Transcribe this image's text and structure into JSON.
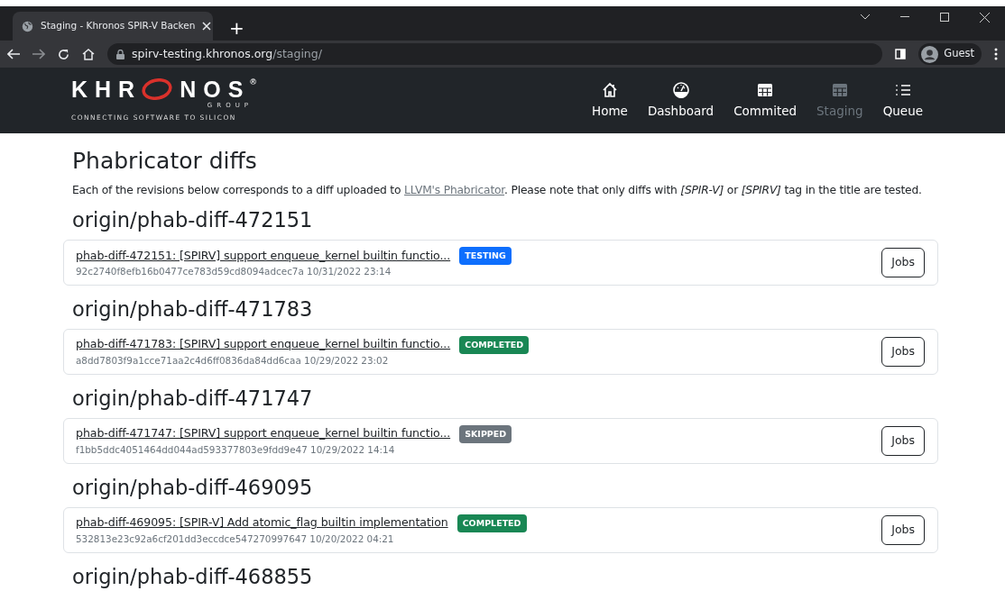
{
  "browser": {
    "tab_title": "Staging - Khronos SPIR-V Backen",
    "new_tab": "+",
    "address_host": "spirv-testing.khronos.org",
    "address_path": "/staging/",
    "profile": "Guest"
  },
  "navbar": {
    "logo": {
      "left": "KHR",
      "right": "NOS",
      "mark": "®",
      "group": "GROUP",
      "tagline": "CONNECTING SOFTWARE TO SILICON"
    },
    "items": [
      {
        "label": "Home",
        "kind": "home",
        "selected": false
      },
      {
        "label": "Dashboard",
        "kind": "gauge",
        "selected": false
      },
      {
        "label": "Commited",
        "kind": "table",
        "selected": false
      },
      {
        "label": "Staging",
        "kind": "table",
        "selected": true
      },
      {
        "label": "Queue",
        "kind": "list",
        "selected": false
      }
    ]
  },
  "page": {
    "title": "Phabricator diffs",
    "intro_before": "Each of the revisions below corresponds to a diff uploaded to ",
    "intro_link": "LLVM's Phabricator",
    "intro_after": ". Please note that only diffs with *[SPIR-V]* or *[SPIRV]* tag in the title are tested."
  },
  "diffs": [
    {
      "branch": "origin/phab-diff-472151",
      "title": "phab-diff-472151: [SPIRV] support enqueue_kernel builtin functio...",
      "status": {
        "label": "TESTING",
        "kind": "testing"
      },
      "commit": "92c2740f8efb16b0477ce783d59cd8094adcec7a 10/31/2022 23:14",
      "button": "Jobs"
    },
    {
      "branch": "origin/phab-diff-471783",
      "title": "phab-diff-471783: [SPIRV] support enqueue_kernel builtin functio...",
      "status": {
        "label": "COMPLETED",
        "kind": "completed"
      },
      "commit": "a8dd7803f9a1cce71aa2c4d6ff0836da84dd6caa 10/29/2022 23:02",
      "button": "Jobs"
    },
    {
      "branch": "origin/phab-diff-471747",
      "title": "phab-diff-471747: [SPIRV] support enqueue_kernel builtin functio...",
      "status": {
        "label": "SKIPPED",
        "kind": "skipped"
      },
      "commit": "f1bb5ddc4051464dd044ad593377803e9fdd9e47 10/29/2022 14:14",
      "button": "Jobs"
    },
    {
      "branch": "origin/phab-diff-469095",
      "title": "phab-diff-469095: [SPIR-V] Add atomic_flag builtin implementation",
      "status": {
        "label": "COMPLETED",
        "kind": "completed"
      },
      "commit": "532813e23c92a6cf201dd3eccdce547270997647 10/20/2022 04:21",
      "button": "Jobs"
    },
    {
      "branch": "origin/phab-diff-468855"
    }
  ]
}
